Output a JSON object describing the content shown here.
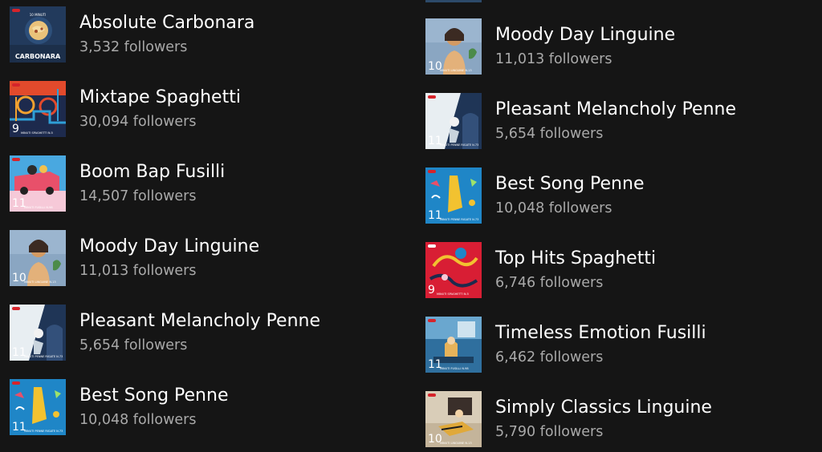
{
  "left_column": [
    {
      "title": "Absolute Carbonara",
      "followers": "3,532 followers",
      "art": "carbonara-art-icon",
      "cover_big": "CARBONARA",
      "cover_small": "10 MINUTI"
    },
    {
      "title": "Mixtape Spaghetti",
      "followers": "30,094 followers",
      "art": "mixtape-art-icon",
      "cover_num": "9",
      "cover_sub": "MINUTI SPAGHETTI N.5"
    },
    {
      "title": "Boom Bap Fusilli",
      "followers": "14,507 followers",
      "art": "boombap-art-icon",
      "cover_num": "11",
      "cover_sub": "MINUTI FUSILLI N.98"
    },
    {
      "title": "Moody Day Linguine",
      "followers": "11,013 followers",
      "art": "moody-art-icon",
      "cover_num": "10",
      "cover_sub": "MINUTI LINGUINE N.13"
    },
    {
      "title": "Pleasant Melancholy Penne",
      "followers": "5,654 followers",
      "art": "melancholy-art-icon",
      "cover_num": "11",
      "cover_sub": "MINUTI PENNE RIGATE N.73"
    },
    {
      "title": "Best Song Penne",
      "followers": "10,048 followers",
      "art": "bestsong-art-icon",
      "cover_num": "11",
      "cover_sub": "MINUTI PENNE RIGATE N.73"
    }
  ],
  "right_column": [
    {
      "title": "Moody Day Linguine",
      "followers": "11,013 followers",
      "art": "moody-art-icon",
      "cover_num": "10",
      "cover_sub": "MINUTI LINGUINE N.13"
    },
    {
      "title": "Pleasant Melancholy Penne",
      "followers": "5,654 followers",
      "art": "melancholy-art-icon",
      "cover_num": "11",
      "cover_sub": "MINUTI PENNE RIGATE N.73"
    },
    {
      "title": "Best Song Penne",
      "followers": "10,048 followers",
      "art": "bestsong-art-icon",
      "cover_num": "11",
      "cover_sub": "MINUTI PENNE RIGATE N.73"
    },
    {
      "title": "Top Hits Spaghetti",
      "followers": "6,746 followers",
      "art": "tophits-art-icon",
      "cover_num": "9",
      "cover_sub": "MINUTI SPAGHETTI N.5"
    },
    {
      "title": "Timeless Emotion Fusilli",
      "followers": "6,462 followers",
      "art": "timeless-art-icon",
      "cover_num": "11",
      "cover_sub": "MINUTI FUSILLI N.98"
    },
    {
      "title": "Simply Classics Linguine",
      "followers": "5,790 followers",
      "art": "classics-art-icon",
      "cover_num": "10",
      "cover_sub": "MINUTI LINGUINE N.13"
    }
  ],
  "brand_label": "Barilla",
  "colors": {
    "background": "#151515",
    "title": "#ffffff",
    "subtitle": "#a9a9a9",
    "brand_red": "#d6242b"
  }
}
